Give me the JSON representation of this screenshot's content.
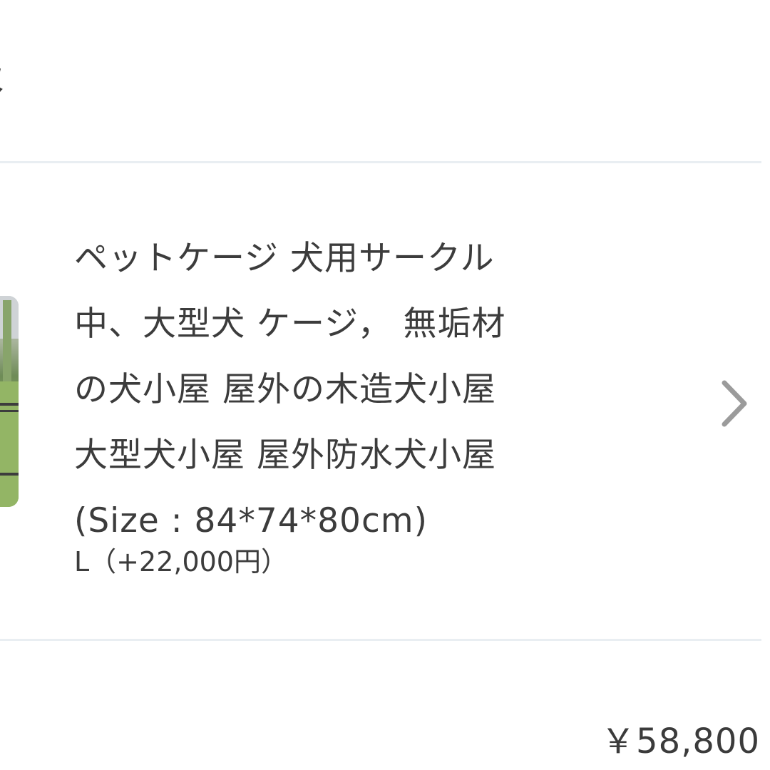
{
  "section": {
    "title_fragment": "報"
  },
  "product": {
    "title": "ペットケージ 犬用サークル\n中、大型犬 ケージ， 無垢材\nの犬小屋 屋外の木造犬小屋\n大型犬小屋 屋外防水犬小屋\n(Size : 84*74*80cm)",
    "variant": "L（+22,000円）",
    "thumbnail_icon": "product-photo",
    "chevron_icon": "chevron-right-icon"
  },
  "summary": {
    "price": "￥58,800"
  },
  "colors": {
    "text": "#3c3c3c",
    "divider": "#e9eef2",
    "chevron": "#9b9b9b"
  }
}
